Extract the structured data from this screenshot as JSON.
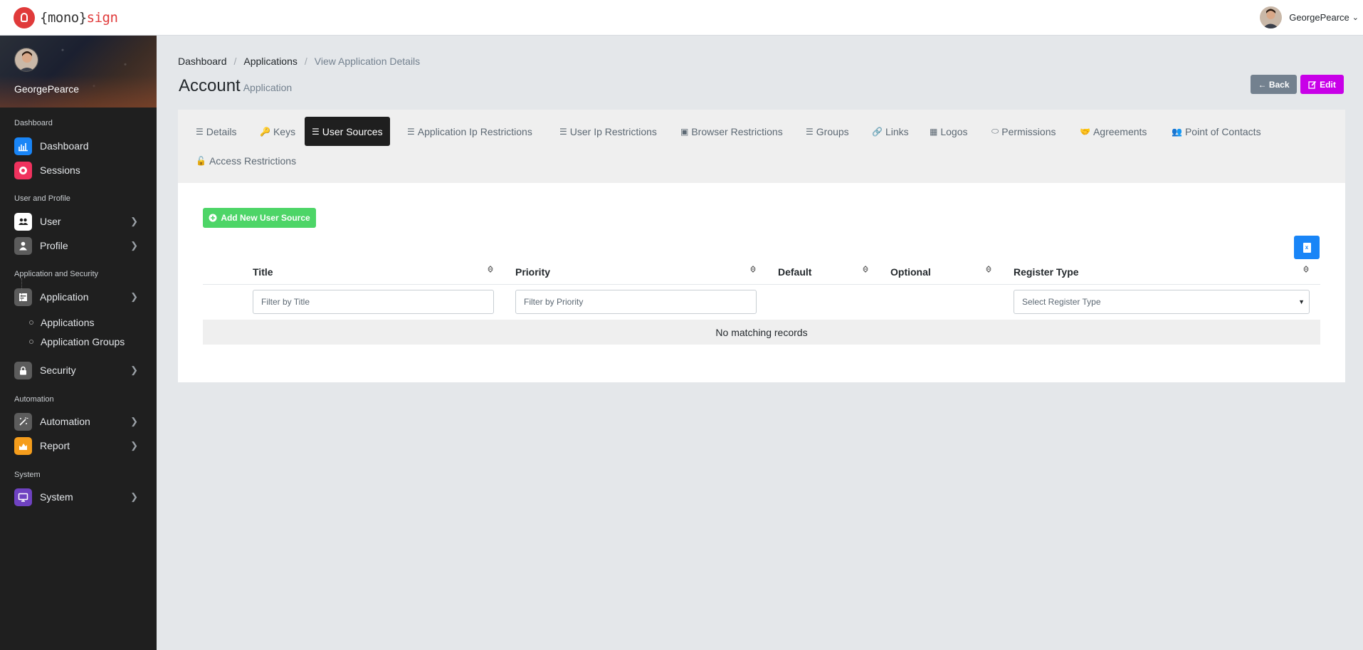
{
  "brand": {
    "prefix": "{mono}",
    "suffix": "sign"
  },
  "top_user": {
    "name": "GeorgePearce"
  },
  "sidebar": {
    "user_name": "GeorgePearce",
    "sections": {
      "dashboard": "Dashboard",
      "user_profile": "User and Profile",
      "app_security": "Application and Security",
      "automation": "Automation",
      "system": "System"
    },
    "items": {
      "dashboard": "Dashboard",
      "sessions": "Sessions",
      "user": "User",
      "profile": "Profile",
      "application": "Application",
      "applications": "Applications",
      "application_groups": "Application Groups",
      "security": "Security",
      "automation": "Automation",
      "report": "Report",
      "system": "System"
    },
    "colors": {
      "dashboard": "#1985f7",
      "sessions": "#f0325e",
      "user": "#ffffff",
      "profile": "#5c5c5c",
      "application": "#5c5c5c",
      "security": "#5c5c5c",
      "automation": "#5c5c5c",
      "report": "#f59d1c",
      "system": "#6f42c1"
    }
  },
  "breadcrumb": {
    "b1": "Dashboard",
    "b2": "Applications",
    "b3": "View Application Details"
  },
  "page": {
    "title": "Account",
    "subtitle": "Application"
  },
  "buttons": {
    "back": "← Back",
    "edit": "Edit"
  },
  "tabs": {
    "details": "Details",
    "keys": "Keys",
    "user_sources": "User Sources",
    "app_ip": "Application Ip Restrictions",
    "user_ip": "User Ip Restrictions",
    "browser": "Browser Restrictions",
    "groups": "Groups",
    "links": "Links",
    "logos": "Logos",
    "permissions": "Permissions",
    "agreements": "Agreements",
    "poc": "Point of Contacts",
    "access": "Access Restrictions"
  },
  "add_button": "Add New User Source",
  "table": {
    "columns": {
      "title": "Title",
      "priority": "Priority",
      "default": "Default",
      "optional": "Optional",
      "register_type": "Register Type"
    },
    "filters": {
      "title": "Filter by Title",
      "priority": "Filter by Priority",
      "register_type": "Select Register Type"
    },
    "empty": "No matching records"
  }
}
